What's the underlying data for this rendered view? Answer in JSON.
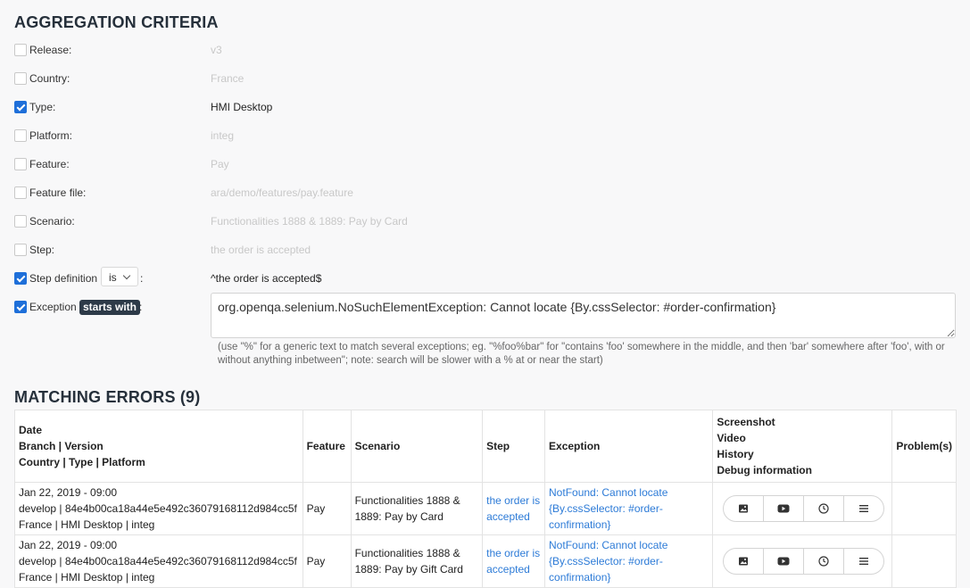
{
  "criteria": {
    "title": "AGGREGATION CRITERIA",
    "rows": [
      {
        "label": "Release:",
        "value": "v3",
        "checked": false
      },
      {
        "label": "Country:",
        "value": "France",
        "checked": false
      },
      {
        "label": "Type:",
        "value": "HMI Desktop",
        "checked": true
      },
      {
        "label": "Platform:",
        "value": "integ",
        "checked": false
      },
      {
        "label": "Feature:",
        "value": "Pay",
        "checked": false
      },
      {
        "label": "Feature file:",
        "value": "ara/demo/features/pay.feature",
        "checked": false
      },
      {
        "label": "Scenario:",
        "value": "Functionalities 1888 & 1889: Pay by Card",
        "checked": false
      },
      {
        "label": "Step:",
        "value": "the order is accepted",
        "checked": false
      }
    ],
    "step_definition": {
      "label": "Step definition",
      "select_value": "is",
      "colon": ":",
      "value": "^the order is accepted$",
      "checked": true
    },
    "exception": {
      "label": "Exception",
      "badge": "starts with",
      "colon": ":",
      "value": "org.openqa.selenium.NoSuchElementException: Cannot locate {By.cssSelector: #order-confirmation}",
      "checked": true,
      "help": "(use \"%\" for a generic text to match several exceptions; eg. \"%foo%bar\" for \"contains 'foo' somewhere in the middle, and then 'bar' somewhere after 'foo', with or without anything inbetween\"; note: search will be slower with a % at or near the start)"
    }
  },
  "errors": {
    "title": "MATCHING ERRORS (9)",
    "headers": {
      "date": "Date",
      "branch": "Branch | Version",
      "country": "Country | Type | Platform",
      "feature": "Feature",
      "scenario": "Scenario",
      "step": "Step",
      "exception": "Exception",
      "screenshot": "Screenshot",
      "video": "Video",
      "history": "History",
      "debug": "Debug information",
      "problems": "Problem(s)"
    },
    "rows": [
      {
        "date": "Jan 22, 2019 - 09:00",
        "branch": "develop | 84e4b00ca18a44e5e492c36079168112d984cc5f",
        "country": "France | HMI Desktop | integ",
        "feature": "Pay",
        "scenario": "Functionalities 1888 & 1889: Pay by Card",
        "step": "the order is accepted",
        "exception": "NotFound: Cannot locate {By.cssSelector: #order-confirmation}",
        "problems": ""
      },
      {
        "date": "Jan 22, 2019 - 09:00",
        "branch": "develop | 84e4b00ca18a44e5e492c36079168112d984cc5f",
        "country": "France | HMI Desktop | integ",
        "feature": "Pay",
        "scenario": "Functionalities 1888 & 1889: Pay by Gift Card",
        "step": "the order is accepted",
        "exception": "NotFound: Cannot locate {By.cssSelector: #order-confirmation}",
        "problems": ""
      }
    ]
  },
  "colors": {
    "accent": "#1e6fd9",
    "link": "#2d7bd7",
    "badge_bg": "#2d3a48",
    "disabled_text": "#c8c8c8"
  },
  "icons": [
    "image-icon",
    "youtube-icon",
    "clock-icon",
    "menu-icon",
    "chevron-down-icon",
    "check-icon"
  ]
}
